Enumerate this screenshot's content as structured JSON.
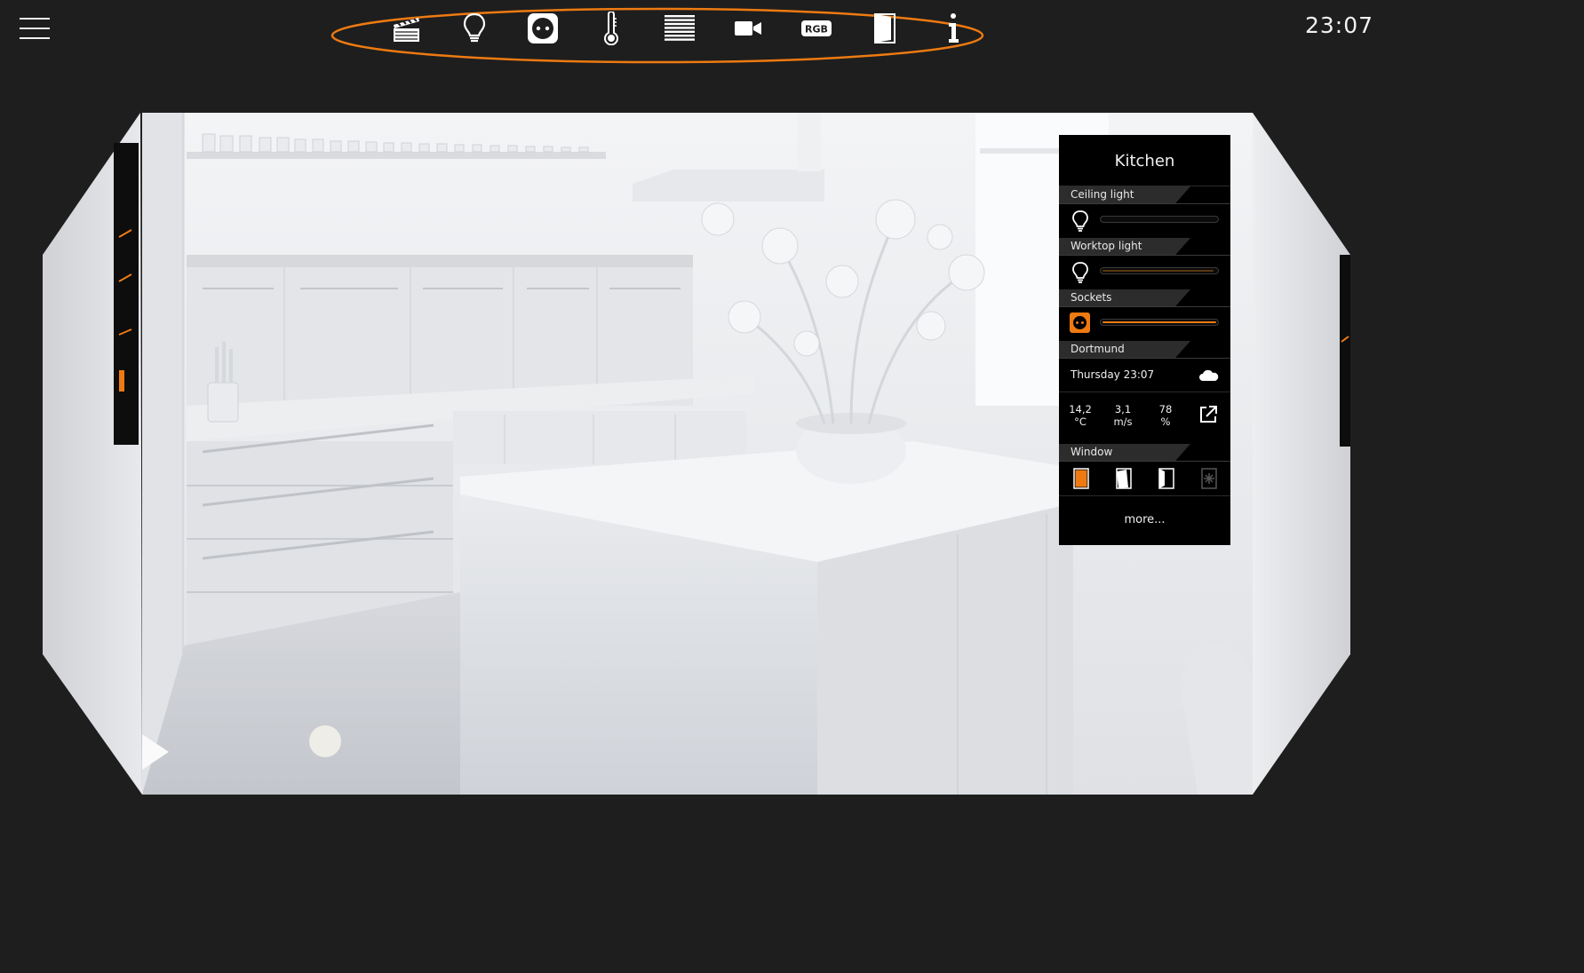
{
  "header": {
    "clock": "23:07",
    "toolbar": [
      {
        "name": "scenes-tool",
        "icon": "clapperboard-icon"
      },
      {
        "name": "lights-tool",
        "icon": "bulb-icon"
      },
      {
        "name": "sockets-tool",
        "icon": "socket-icon"
      },
      {
        "name": "heating-tool",
        "icon": "thermometer-icon"
      },
      {
        "name": "blinds-tool",
        "icon": "blinds-icon"
      },
      {
        "name": "camera-tool",
        "icon": "camera-icon"
      },
      {
        "name": "rgb-tool",
        "icon": "rgb-icon",
        "label": "RGB"
      },
      {
        "name": "windows-tool",
        "icon": "window-icon"
      },
      {
        "name": "info-tool",
        "icon": "info-icon"
      }
    ],
    "highlight_color": "#ee7a12"
  },
  "panel": {
    "title": "Kitchen",
    "ceiling": {
      "label": "Ceiling light",
      "level": 0
    },
    "worktop": {
      "label": "Worktop light",
      "level": 0.98
    },
    "sockets": {
      "label": "Sockets",
      "level": 1.0
    },
    "weather": {
      "label": "Dortmund",
      "date": "Thursday 23:07",
      "temp": "14,2",
      "temp_unit": "°C",
      "wind": "3,1",
      "wind_unit": "m/s",
      "humidity": "78",
      "humidity_unit": "%"
    },
    "window": {
      "label": "Window"
    },
    "more": "more...",
    "accent": "#ee7a12"
  }
}
